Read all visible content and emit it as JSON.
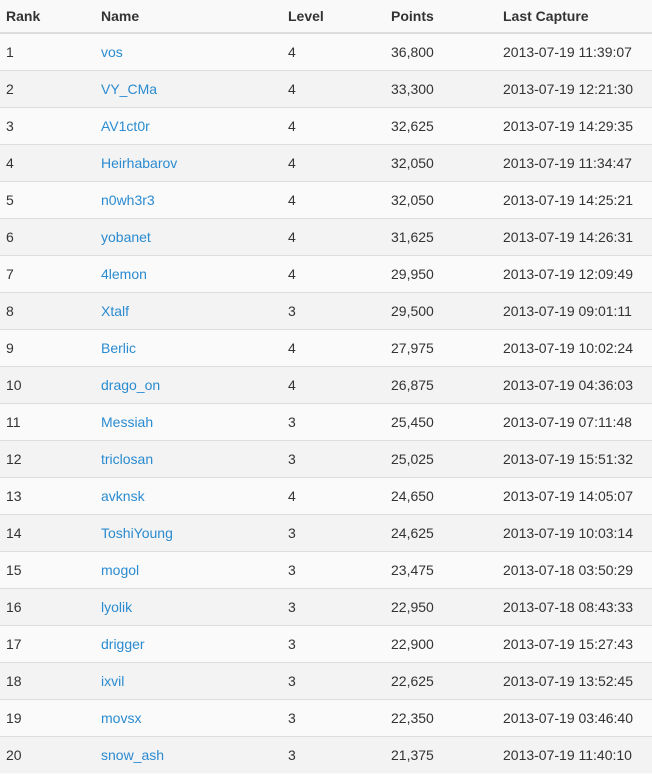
{
  "table": {
    "headers": [
      "Rank",
      "Name",
      "Level",
      "Points",
      "Last Capture"
    ],
    "rows": [
      [
        "1",
        "vos",
        "4",
        "36,800",
        "2013-07-19 11:39:07"
      ],
      [
        "2",
        "VY_CMa",
        "4",
        "33,300",
        "2013-07-19 12:21:30"
      ],
      [
        "3",
        "AV1ct0r",
        "4",
        "32,625",
        "2013-07-19 14:29:35"
      ],
      [
        "4",
        "Heirhabarov",
        "4",
        "32,050",
        "2013-07-19 11:34:47"
      ],
      [
        "5",
        "n0wh3r3",
        "4",
        "32,050",
        "2013-07-19 14:25:21"
      ],
      [
        "6",
        "yobanet",
        "4",
        "31,625",
        "2013-07-19 14:26:31"
      ],
      [
        "7",
        "4lemon",
        "4",
        "29,950",
        "2013-07-19 12:09:49"
      ],
      [
        "8",
        "Xtalf",
        "3",
        "29,500",
        "2013-07-19 09:01:11"
      ],
      [
        "9",
        "Berlic",
        "4",
        "27,975",
        "2013-07-19 10:02:24"
      ],
      [
        "10",
        "drago_on",
        "4",
        "26,875",
        "2013-07-19 04:36:03"
      ],
      [
        "11",
        "Messiah",
        "3",
        "25,450",
        "2013-07-19 07:11:48"
      ],
      [
        "12",
        "triclosan",
        "3",
        "25,025",
        "2013-07-19 15:51:32"
      ],
      [
        "13",
        "avknsk",
        "4",
        "24,650",
        "2013-07-19 14:05:07"
      ],
      [
        "14",
        "ToshiYoung",
        "3",
        "24,625",
        "2013-07-19 10:03:14"
      ],
      [
        "15",
        "mogol",
        "3",
        "23,475",
        "2013-07-18 03:50:29"
      ],
      [
        "16",
        "lyolik",
        "3",
        "22,950",
        "2013-07-18 08:43:33"
      ],
      [
        "17",
        "drigger",
        "3",
        "22,900",
        "2013-07-19 15:27:43"
      ],
      [
        "18",
        "ixvil",
        "3",
        "22,625",
        "2013-07-19 13:52:45"
      ],
      [
        "19",
        "movsx",
        "3",
        "22,350",
        "2013-07-19 03:46:40"
      ],
      [
        "20",
        "snow_ash",
        "3",
        "21,375",
        "2013-07-19 11:40:10"
      ]
    ]
  },
  "colors": {
    "link": "#2a8bd0",
    "text": "#333333",
    "border": "#dddddd"
  }
}
